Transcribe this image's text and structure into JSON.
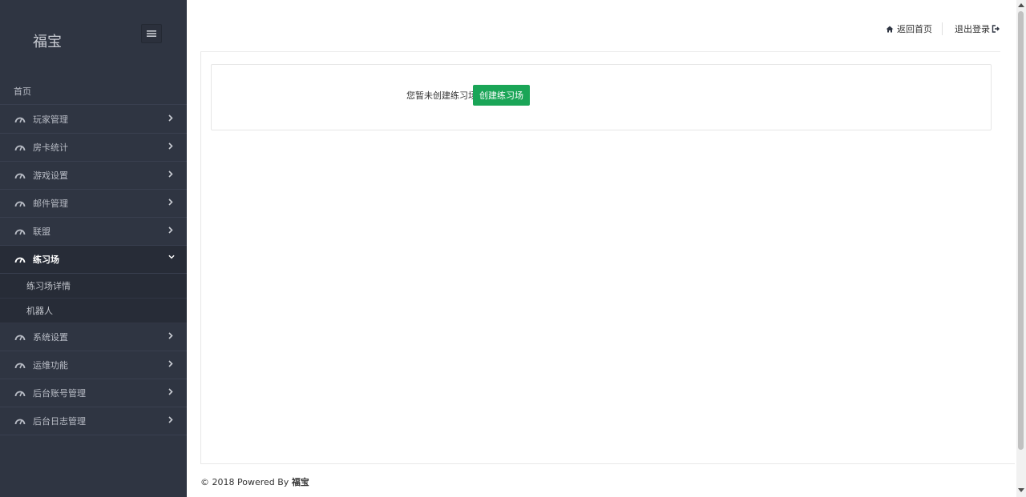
{
  "sidebar": {
    "brand": "福宝",
    "toggle_icon": "hamburger-icon",
    "home": "首页",
    "items": [
      {
        "label": "玩家管理",
        "icon": "dashboard-gauge-icon"
      },
      {
        "label": "房卡统计",
        "icon": "dashboard-gauge-icon"
      },
      {
        "label": "游戏设置",
        "icon": "dashboard-gauge-icon"
      },
      {
        "label": "邮件管理",
        "icon": "dashboard-gauge-icon"
      },
      {
        "label": "联盟",
        "icon": "dashboard-gauge-icon"
      },
      {
        "label": "练习场",
        "icon": "dashboard-gauge-icon",
        "active": true,
        "children": [
          {
            "label": "练习场详情"
          },
          {
            "label": "机器人"
          }
        ]
      },
      {
        "label": "系统设置",
        "icon": "dashboard-gauge-icon"
      },
      {
        "label": "运维功能",
        "icon": "dashboard-gauge-icon"
      },
      {
        "label": "后台账号管理",
        "icon": "dashboard-gauge-icon"
      },
      {
        "label": "后台日志管理",
        "icon": "dashboard-gauge-icon"
      }
    ]
  },
  "header": {
    "home_link": "返回首页",
    "logout_link": "退出登录"
  },
  "main": {
    "empty_message": "您暂未创建练习场",
    "create_button": "创建练习场"
  },
  "footer": {
    "prefix": "© 2018 Powered By",
    "brand": "福宝"
  },
  "colors": {
    "sidebar_bg": "#2f3542",
    "sidebar_active_bg": "#272c37",
    "primary_button": "#1aa557"
  }
}
